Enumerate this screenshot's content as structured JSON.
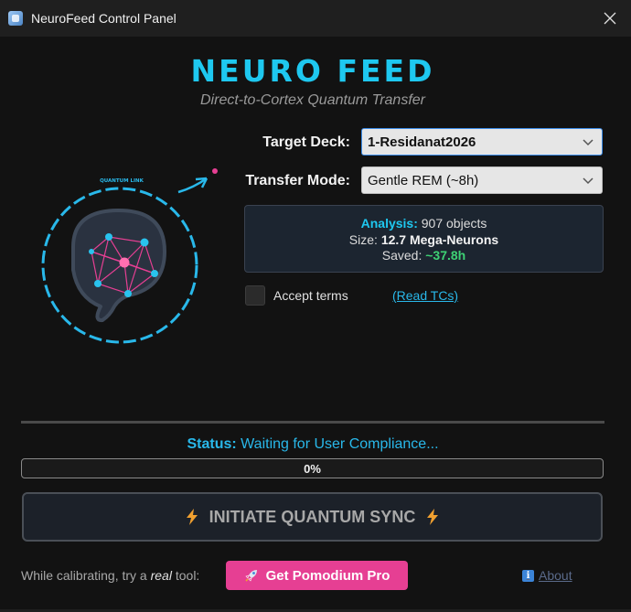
{
  "window": {
    "title": "NeuroFeed Control Panel",
    "close_icon": "close-icon"
  },
  "header": {
    "title": "NEURO FEED",
    "subtitle": "Direct-to-Cortex Quantum Transfer"
  },
  "illustration": {
    "label": "QUANTUM LINK",
    "accent": "#1ec8f0",
    "node_color": "#e63f93"
  },
  "form": {
    "target_deck": {
      "label": "Target Deck:",
      "value": "1-Residanat2026"
    },
    "transfer_mode": {
      "label": "Transfer Mode:",
      "value": "Gentle REM (~8h)"
    }
  },
  "analysis": {
    "label": "Analysis:",
    "objects": "907 objects",
    "size_label": "Size:",
    "size_value": "12.7 Mega-Neurons",
    "saved_label": "Saved:",
    "saved_value": "~37.8h"
  },
  "terms": {
    "checked": false,
    "label": "Accept terms",
    "link": "(Read TCs)"
  },
  "status": {
    "label": "Status:",
    "text": "Waiting for User Compliance...",
    "progress": 0,
    "progress_text": "0%"
  },
  "sync_button": {
    "label": "INITIATE QUANTUM SYNC",
    "icon": "lightning-icon",
    "icon_color": "#f0a030"
  },
  "footer": {
    "text_before": "While calibrating, try a ",
    "text_em": "real",
    "text_after": " tool:",
    "promo_button": "Get Pomodium Pro",
    "promo_icon": "rocket-icon",
    "about_icon": "info-icon",
    "about_link": "About"
  },
  "colors": {
    "background": "#121212",
    "accent": "#1ec8f0",
    "success": "#3ed174",
    "promo": "#e63f93"
  }
}
